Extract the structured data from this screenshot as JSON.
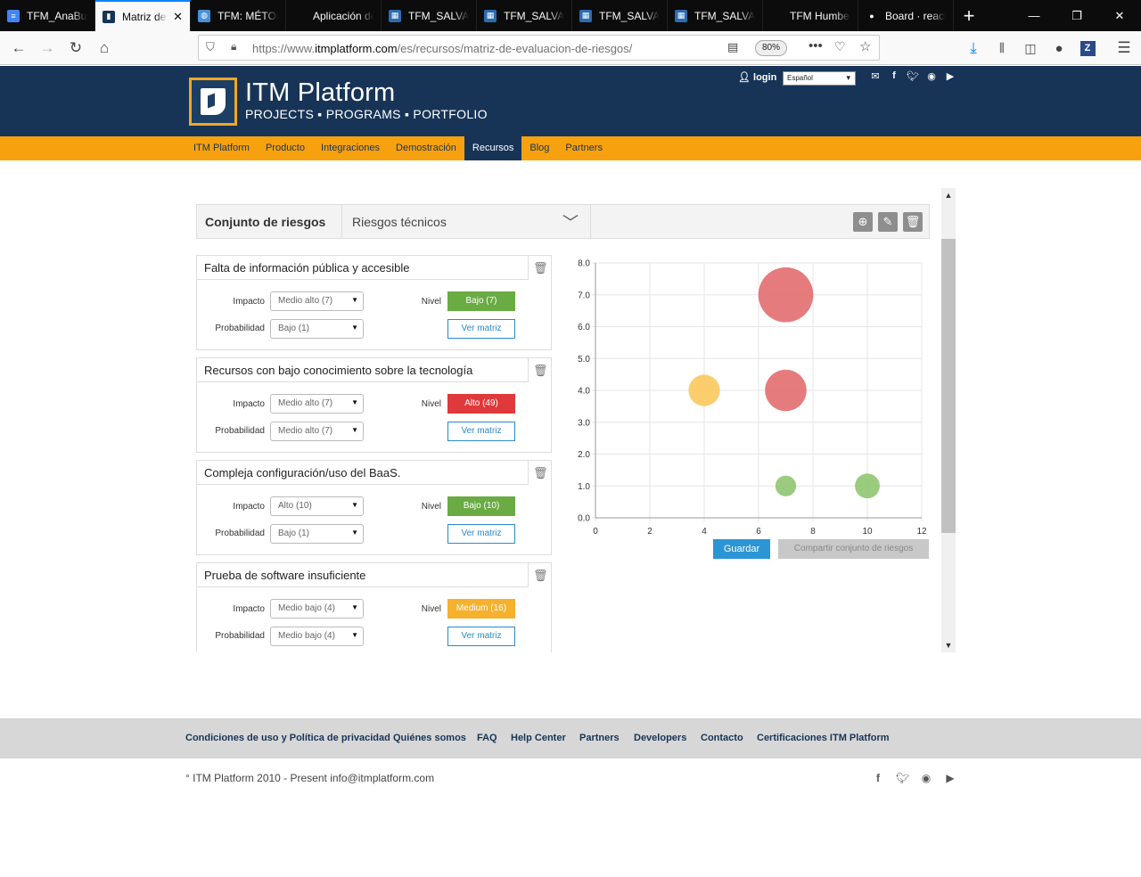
{
  "browser": {
    "tabs": [
      {
        "label": "TFM_AnaBu",
        "icon": "docs-icon",
        "color": "#4285f4"
      },
      {
        "label": "Matriz de",
        "icon": "itm-icon",
        "color": "#173457",
        "active": true
      },
      {
        "label": "TFM: MÉTOD",
        "icon": "globe-icon",
        "color": "#4a90d9"
      },
      {
        "label": "Aplicación de M",
        "icon": "blank",
        "color": "#0c0c0d"
      },
      {
        "label": "TFM_SALVAD",
        "icon": "doc-icon",
        "color": "#2b6cb0"
      },
      {
        "label": "TFM_SALVAD",
        "icon": "doc-icon",
        "color": "#2b6cb0"
      },
      {
        "label": "TFM_SALVAD",
        "icon": "doc-icon",
        "color": "#2b6cb0"
      },
      {
        "label": "TFM_SALVAD",
        "icon": "doc-icon",
        "color": "#2b6cb0"
      },
      {
        "label": "TFM Humberto",
        "icon": "blank",
        "color": "#0c0c0d"
      },
      {
        "label": "Board · react",
        "icon": "github-icon",
        "color": "#0c0c0d"
      }
    ],
    "url_prefix": "https://www.",
    "url_domain": "itmplatform.com",
    "url_path": "/es/recursos/matriz-de-evaluacion-de-riesgos/",
    "zoom": "80%"
  },
  "site": {
    "brand": "ITM Platform",
    "tagline": "PROJECTS ▪ PROGRAMS ▪ PORTFOLIO",
    "login": "login",
    "language": "Español",
    "menu": [
      "ITM Platform",
      "Producto",
      "Integraciones",
      "Demostración",
      "Recursos",
      "Blog",
      "Partners"
    ],
    "menu_active": "Recursos"
  },
  "app": {
    "set_label": "Conjunto de riesgos",
    "set_value": "Riesgos técnicos",
    "impact_label": "Impacto",
    "prob_label": "Probabilidad",
    "level_label": "Nivel",
    "view_matrix": "Ver matriz",
    "save": "Guardar",
    "share": "Compartir conjunto de riesgos",
    "risks": [
      {
        "title": "Falta de información pública y accesible",
        "impact": "Medio alto (7)",
        "probability": "Bajo (1)",
        "level": "Bajo (7)",
        "level_color": "#6aab44"
      },
      {
        "title": "Recursos con bajo conocimiento sobre la tecnología",
        "impact": "Medio alto (7)",
        "probability": "Medio alto (7)",
        "level": "Alto (49)",
        "level_color": "#e0393b"
      },
      {
        "title": "Compleja configuración/uso del BaaS.",
        "impact": "Alto (10)",
        "probability": "Bajo (1)",
        "level": "Bajo (10)",
        "level_color": "#6aab44"
      },
      {
        "title": "Prueba de software insuficiente",
        "impact": "Medio bajo (4)",
        "probability": "Medio bajo (4)",
        "level": "Medium (16)",
        "level_color": "#f5b12e"
      }
    ]
  },
  "chart_data": {
    "type": "scatter",
    "xlim": [
      0,
      12
    ],
    "ylim": [
      0,
      8
    ],
    "x_ticks": [
      "0",
      "2",
      "4",
      "6",
      "8",
      "10",
      "12"
    ],
    "y_ticks": [
      "0.0",
      "1.0",
      "2.0",
      "3.0",
      "4.0",
      "5.0",
      "6.0",
      "7.0",
      "8.0"
    ],
    "grid": true,
    "points": [
      {
        "x": 7,
        "y": 7,
        "size": 49,
        "color": "#e26d6f"
      },
      {
        "x": 4,
        "y": 4,
        "size": 16,
        "color": "#fcc85c"
      },
      {
        "x": 7,
        "y": 4,
        "size": 28,
        "color": "#e26d6f"
      },
      {
        "x": 7,
        "y": 1,
        "size": 7,
        "color": "#90c570"
      },
      {
        "x": 10,
        "y": 1,
        "size": 10,
        "color": "#90c570"
      }
    ]
  },
  "footer": {
    "links": [
      "Condiciones de uso y Política de privacidad",
      "Quiénes somos",
      "FAQ",
      "Help Center",
      "Partners",
      "Developers",
      "Contacto",
      "Certificaciones ITM Platform"
    ],
    "copyright": "° ITM Platform 2010 - Present info@itmplatform.com"
  }
}
